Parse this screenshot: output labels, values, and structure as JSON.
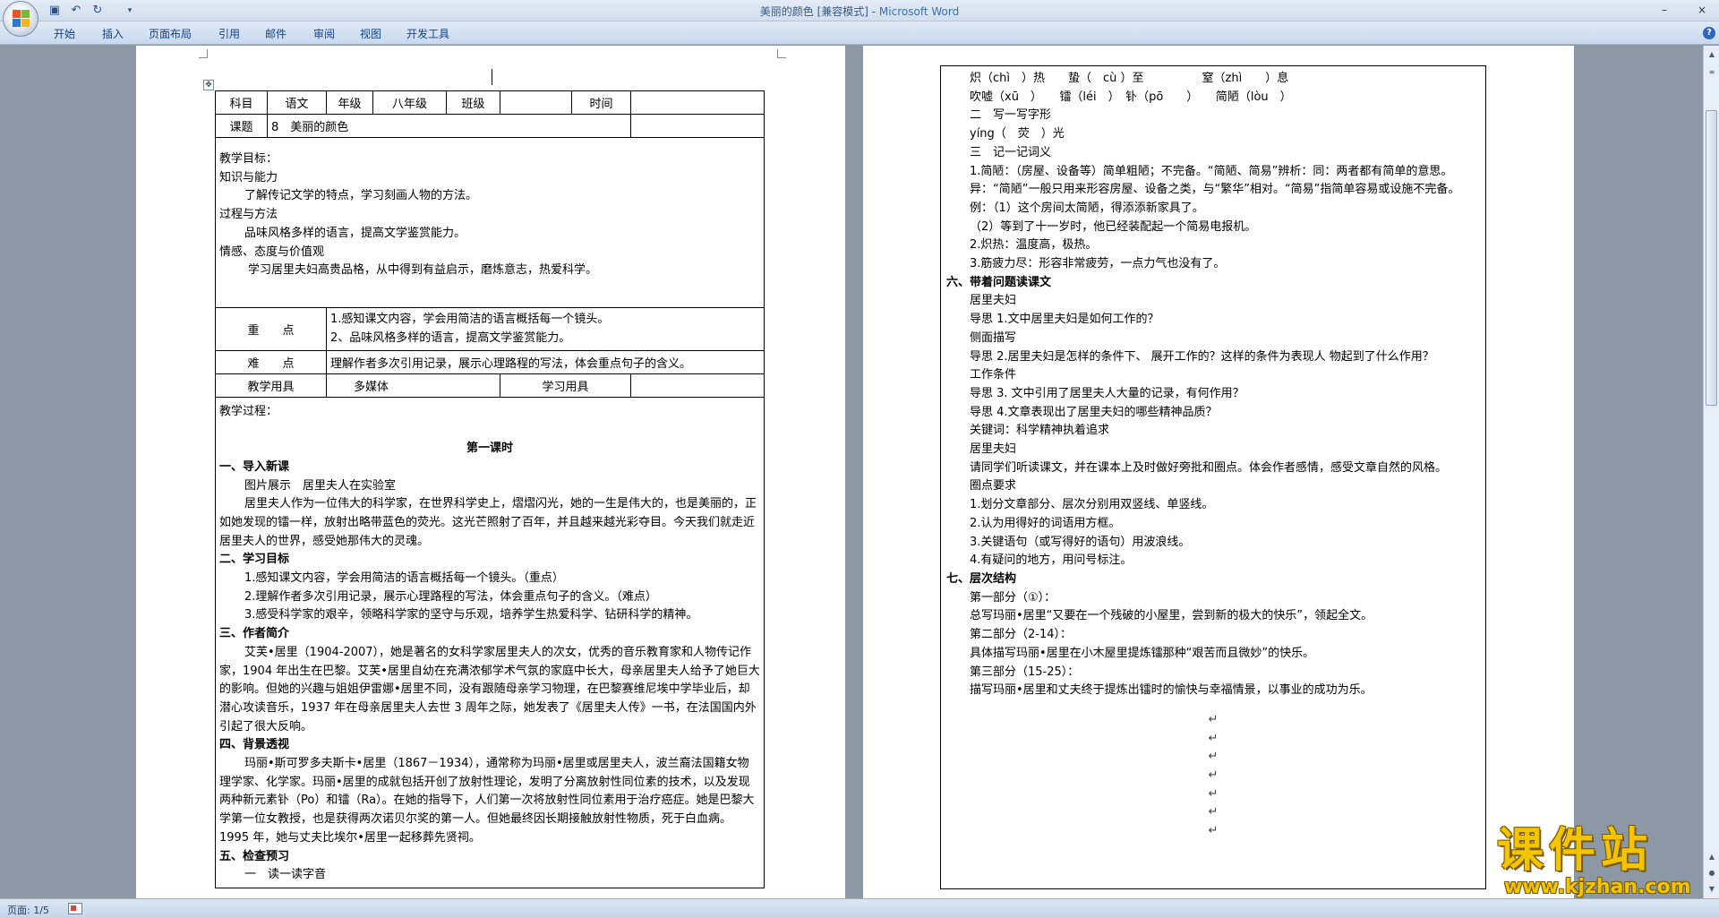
{
  "window": {
    "title_doc": "美丽的颜色 [兼容模式] - ",
    "title_app": "Microsoft Word",
    "minimize": "–",
    "close": "×"
  },
  "quick_access": {
    "save_icon": "save-icon",
    "undo_icon": "undo-icon",
    "redo_icon": "redo-icon",
    "more": "▾"
  },
  "ribbon_tabs": [
    "开始",
    "插入",
    "页面布局",
    "引用",
    "邮件",
    "审阅",
    "视图",
    "开发工具"
  ],
  "help": "?",
  "page1": {
    "table": {
      "r1": {
        "subject_label": "科目",
        "subject": "语文",
        "grade_label": "年级",
        "grade": "八年级",
        "class_label": "班级",
        "class": "",
        "time_label": "时间",
        "time": ""
      },
      "r2": {
        "lesson_label": "课题",
        "lesson": "8　美丽的颜色"
      },
      "goals": [
        "教学目标：",
        "知识与能力",
        "了解传记文学的特点，学习刻画人物的方法。",
        "过程与方法",
        "品味风格多样的语言，提高文学鉴赏能力。",
        "情感、态度与价值观",
        "学习居里夫妇高贵品格，从中得到有益启示，磨炼意志，热爱科学。"
      ],
      "key_label": "重　　点",
      "key_points": [
        "1.感知课文内容，学会用简洁的语言概括每一个镜头。",
        "2、品味风格多样的语言，提高文学鉴赏能力。"
      ],
      "difficult_label": "难　　点",
      "difficult": "理解作者多次引用记录，展示心理路程的写法，体会重点句子的含义。",
      "tools_label": "教学用具",
      "tools": "多媒体",
      "learn_tools_label": "学习用具",
      "learn_tools": ""
    },
    "process": {
      "heading": "教学过程：",
      "first_class": "第一课时",
      "s1_title": "一、导入新课",
      "s1_pic": "图片展示　居里夫人在实验室",
      "s1_text": "居里夫人作为一位伟大的科学家，在世界科学史上，熠熠闪光，她的一生是伟大的，也是美丽的，正如她发现的镭一样，放射出略带蓝色的荧光。这光芒照射了百年，并且越来越光彩夺目。今天我们就走近居里夫人的世界，感受她那伟大的灵魂。",
      "s2_title": "二、学习目标",
      "s2_items": [
        "1.感知课文内容，学会用简洁的语言概括每一个镜头。（重点）",
        "2.理解作者多次引用记录，展示心理路程的写法，体会重点句子的含义。（难点）",
        "3.感受科学家的艰辛，领略科学家的坚守与乐观，培养学生热爱科学、钻研科学的精神。"
      ],
      "s3_title": "三、作者简介",
      "s3_text": "艾芙•居里（1904-2007），她是著名的女科学家居里夫人的次女，优秀的音乐教育家和人物传记作家，1904 年出生在巴黎。艾芙•居里自幼在充满浓郁学术气氛的家庭中长大，母亲居里夫人给予了她巨大的影响。但她的兴趣与姐姐伊雷娜•居里不同，没有跟随母亲学习物理，在巴黎赛维尼埃中学毕业后，却潜心攻读音乐，1937 年在母亲居里夫人去世 3 周年之际，她发表了《居里夫人传》一书，在法国国内外引起了很大反响。",
      "s4_title": "四、背景透视",
      "s4_text": "玛丽•斯可罗多夫斯卡•居里（1867－1934），通常称为玛丽•居里或居里夫人，波兰裔法国籍女物理学家、化学家。玛丽•居里的成就包括开创了放射性理论，发明了分离放射性同位素的技术，以及发现两种新元素钋（Po）和镭（Ra）。在她的指导下，人们第一次将放射性同位素用于治疗癌症。她是巴黎大学第一位女教授，也是获得两次诺贝尔奖的第一人。但她最终因长期接触放射性物质，死于白血病。1995 年，她与丈夫比埃尔•居里一起移葬先贤祠。",
      "s5_title": "五、检查预习",
      "s5_sub": "一　读一读字音"
    }
  },
  "page2": {
    "lines": [
      {
        "t": "炽（chì　）热　　蛰（　cù ）至　　　　　窒（zhì　　）息",
        "c": "i1"
      },
      {
        "t": "吹嘘（xū　）　　镭（léi　）　钋（pō　　）　　简陋（lòu　）",
        "c": "i1"
      },
      {
        "t": "二　写一写字形",
        "c": "i1"
      },
      {
        "t": "yíng（　荧　）光",
        "c": "i1"
      },
      {
        "t": "三　记一记词义",
        "c": "i1"
      },
      {
        "t": "1.简陋：（房屋、设备等）简单粗陋；不完备。“简陋、简易”辨析：同：两者都有简单的意思。",
        "c": "i1 wrap"
      },
      {
        "t": "异：“简陋”一般只用来形容房屋、设备之类，与“繁华”相对。“简易”指简单容易或设施不完备。",
        "c": "i1 wrap"
      },
      {
        "t": "例：（1）这个房间太简陋，得添添新家具了。",
        "c": "i1"
      },
      {
        "t": "（2）等到了十一岁时，他已经装配起一个简易电报机。",
        "c": "i1"
      },
      {
        "t": "2.炽热：温度高，极热。",
        "c": "i1"
      },
      {
        "t": "3.筋疲力尽：形容非常疲劳，一点力气也没有了。",
        "c": "i1"
      },
      {
        "t": "六、带着问题读课文",
        "c": "b"
      },
      {
        "t": "居里夫妇",
        "c": "i1"
      },
      {
        "t": "导思 1.文中居里夫妇是如何工作的？",
        "c": "i1"
      },
      {
        "t": "侧面描写",
        "c": "i1"
      },
      {
        "t": "导思 2.居里夫妇是怎样的条件下、 展开工作的？这样的条件为表现人 物起到了什么作用？",
        "c": "i1"
      },
      {
        "t": "工作条件",
        "c": "i1"
      },
      {
        "t": "导思 3. 文中引用了居里夫人大量的记录，有何作用？",
        "c": "i1"
      },
      {
        "t": "导思 4.文章表现出了居里夫妇的哪些精神品质？",
        "c": "i1"
      },
      {
        "t": "关键词：科学精神执着追求",
        "c": "i1"
      },
      {
        "t": "居里夫妇",
        "c": "i1"
      },
      {
        "t": "请同学们听读课文，并在课本上及时做好旁批和圈点。体会作者感情，感受文章自然的风格。",
        "c": "i1"
      },
      {
        "t": "圈点要求",
        "c": "i1"
      },
      {
        "t": "1.划分文章部分、层次分别用双竖线、单竖线。",
        "c": "i1"
      },
      {
        "t": "2.认为用得好的词语用方框。",
        "c": "i1"
      },
      {
        "t": "3.关键语句（或写得好的语句）用波浪线。",
        "c": "i1"
      },
      {
        "t": "4.有疑问的地方，用问号标注。",
        "c": "i1"
      },
      {
        "t": "七、层次结构",
        "c": "b"
      },
      {
        "t": "第一部分（①）：",
        "c": "i1"
      },
      {
        "t": "总写玛丽•居里“又要在一个残破的小屋里，尝到新的极大的快乐”，领起全文。",
        "c": "i1"
      },
      {
        "t": "第二部分（2-14）：",
        "c": "i1"
      },
      {
        "t": "具体描写玛丽•居里在小木屋里提炼镭那种“艰苦而且微妙”的快乐。",
        "c": "i1"
      },
      {
        "t": "第三部分（15-25）：",
        "c": "i1"
      },
      {
        "t": "描写玛丽•居里和丈夫终于提炼出镭时的愉快与幸福情景，以事业的成功为乐。",
        "c": "i1"
      }
    ]
  },
  "status_bar": {
    "page": "页面: 1/5"
  },
  "watermark": {
    "title": "课件站",
    "url": "www.kjzhan.com"
  },
  "colors": {
    "ribbon_text": "#15428b",
    "app_title": "#3b6fb0",
    "watermark": "#f3c400",
    "workspace": "#8d98a6"
  }
}
